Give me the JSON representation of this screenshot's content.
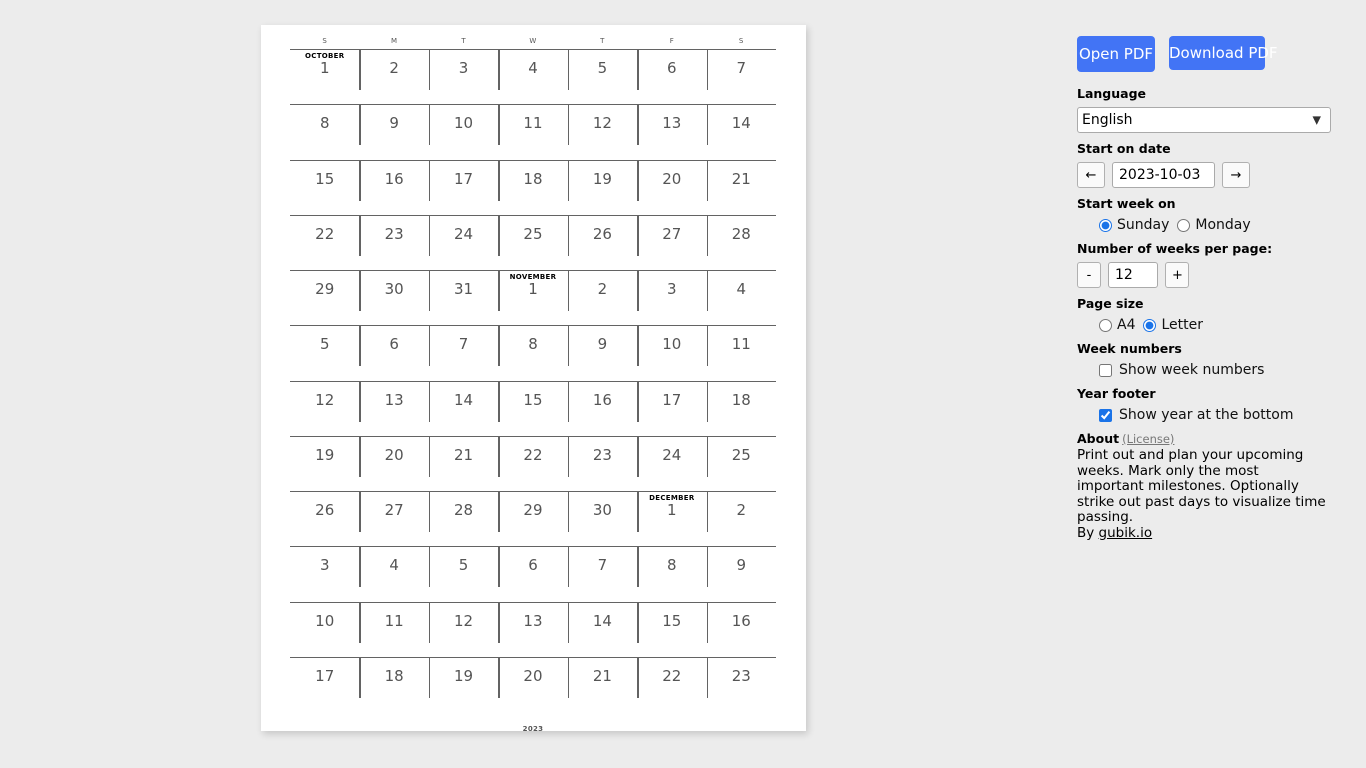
{
  "panel": {
    "open_pdf_label": "Open PDF",
    "download_pdf_label": "Download PDF",
    "language": {
      "label": "Language",
      "selected": "English",
      "caret": "▼"
    },
    "start_on_date": {
      "label": "Start on date",
      "prev_label": "←",
      "next_label": "→",
      "value": "2023-10-03"
    },
    "start_week_on": {
      "label": "Start week on",
      "options": [
        "Sunday",
        "Monday"
      ],
      "selected": "Sunday"
    },
    "weeks_per_page": {
      "label": "Number of weeks per page:",
      "minus_label": "-",
      "plus_label": "+",
      "value": "12"
    },
    "page_size": {
      "label": "Page size",
      "options": [
        "A4",
        "Letter"
      ],
      "selected": "Letter"
    },
    "week_numbers": {
      "label": "Week numbers",
      "checkbox_label": "Show week numbers",
      "checked": false
    },
    "year_footer": {
      "label": "Year footer",
      "checkbox_label": "Show year at the bottom",
      "checked": true
    },
    "about": {
      "label": "About",
      "license_label": "(License)",
      "body": "Print out and plan your upcoming weeks. Mark only the most important milestones. Optionally strike out past days to visualize time passing.",
      "by_prefix": "By ",
      "by_link": "gubik.io"
    },
    "accent_color": "#4274f5"
  },
  "calendar": {
    "day_headers": [
      "S",
      "M",
      "T",
      "W",
      "T",
      "F",
      "S"
    ],
    "year_footer_text": "2023",
    "weeks": [
      [
        {
          "d": "1",
          "m": "OCTOBER"
        },
        {
          "d": "2",
          "m": ""
        },
        {
          "d": "3",
          "m": ""
        },
        {
          "d": "4",
          "m": ""
        },
        {
          "d": "5",
          "m": ""
        },
        {
          "d": "6",
          "m": ""
        },
        {
          "d": "7",
          "m": ""
        }
      ],
      [
        {
          "d": "8",
          "m": ""
        },
        {
          "d": "9",
          "m": ""
        },
        {
          "d": "10",
          "m": ""
        },
        {
          "d": "11",
          "m": ""
        },
        {
          "d": "12",
          "m": ""
        },
        {
          "d": "13",
          "m": ""
        },
        {
          "d": "14",
          "m": ""
        }
      ],
      [
        {
          "d": "15",
          "m": ""
        },
        {
          "d": "16",
          "m": ""
        },
        {
          "d": "17",
          "m": ""
        },
        {
          "d": "18",
          "m": ""
        },
        {
          "d": "19",
          "m": ""
        },
        {
          "d": "20",
          "m": ""
        },
        {
          "d": "21",
          "m": ""
        }
      ],
      [
        {
          "d": "22",
          "m": ""
        },
        {
          "d": "23",
          "m": ""
        },
        {
          "d": "24",
          "m": ""
        },
        {
          "d": "25",
          "m": ""
        },
        {
          "d": "26",
          "m": ""
        },
        {
          "d": "27",
          "m": ""
        },
        {
          "d": "28",
          "m": ""
        }
      ],
      [
        {
          "d": "29",
          "m": ""
        },
        {
          "d": "30",
          "m": ""
        },
        {
          "d": "31",
          "m": ""
        },
        {
          "d": "1",
          "m": "NOVEMBER"
        },
        {
          "d": "2",
          "m": ""
        },
        {
          "d": "3",
          "m": ""
        },
        {
          "d": "4",
          "m": ""
        }
      ],
      [
        {
          "d": "5",
          "m": ""
        },
        {
          "d": "6",
          "m": ""
        },
        {
          "d": "7",
          "m": ""
        },
        {
          "d": "8",
          "m": ""
        },
        {
          "d": "9",
          "m": ""
        },
        {
          "d": "10",
          "m": ""
        },
        {
          "d": "11",
          "m": ""
        }
      ],
      [
        {
          "d": "12",
          "m": ""
        },
        {
          "d": "13",
          "m": ""
        },
        {
          "d": "14",
          "m": ""
        },
        {
          "d": "15",
          "m": ""
        },
        {
          "d": "16",
          "m": ""
        },
        {
          "d": "17",
          "m": ""
        },
        {
          "d": "18",
          "m": ""
        }
      ],
      [
        {
          "d": "19",
          "m": ""
        },
        {
          "d": "20",
          "m": ""
        },
        {
          "d": "21",
          "m": ""
        },
        {
          "d": "22",
          "m": ""
        },
        {
          "d": "23",
          "m": ""
        },
        {
          "d": "24",
          "m": ""
        },
        {
          "d": "25",
          "m": ""
        }
      ],
      [
        {
          "d": "26",
          "m": ""
        },
        {
          "d": "27",
          "m": ""
        },
        {
          "d": "28",
          "m": ""
        },
        {
          "d": "29",
          "m": ""
        },
        {
          "d": "30",
          "m": ""
        },
        {
          "d": "1",
          "m": "DECEMBER"
        },
        {
          "d": "2",
          "m": ""
        }
      ],
      [
        {
          "d": "3",
          "m": ""
        },
        {
          "d": "4",
          "m": ""
        },
        {
          "d": "5",
          "m": ""
        },
        {
          "d": "6",
          "m": ""
        },
        {
          "d": "7",
          "m": ""
        },
        {
          "d": "8",
          "m": ""
        },
        {
          "d": "9",
          "m": ""
        }
      ],
      [
        {
          "d": "10",
          "m": ""
        },
        {
          "d": "11",
          "m": ""
        },
        {
          "d": "12",
          "m": ""
        },
        {
          "d": "13",
          "m": ""
        },
        {
          "d": "14",
          "m": ""
        },
        {
          "d": "15",
          "m": ""
        },
        {
          "d": "16",
          "m": ""
        }
      ],
      [
        {
          "d": "17",
          "m": ""
        },
        {
          "d": "18",
          "m": ""
        },
        {
          "d": "19",
          "m": ""
        },
        {
          "d": "20",
          "m": ""
        },
        {
          "d": "21",
          "m": ""
        },
        {
          "d": "22",
          "m": ""
        },
        {
          "d": "23",
          "m": ""
        }
      ]
    ]
  }
}
